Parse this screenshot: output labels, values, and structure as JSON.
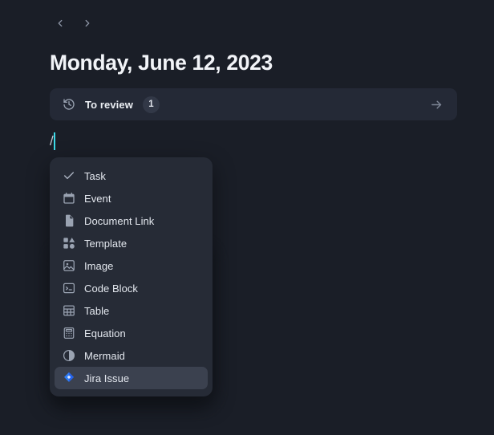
{
  "nav": {
    "prev_label": "Previous day",
    "next_label": "Next day",
    "prev_icon": "chevron-left-icon",
    "next_icon": "chevron-right-icon"
  },
  "header": {
    "title": "Monday, June 12, 2023"
  },
  "review_bar": {
    "icon": "history-icon",
    "label": "To review",
    "count": "1",
    "arrow_icon": "arrow-right-icon"
  },
  "editor": {
    "typed_text": "/",
    "caret_color": "#3ddbe8"
  },
  "slash_menu": {
    "items": [
      {
        "label": "Task",
        "icon": "check-icon"
      },
      {
        "label": "Event",
        "icon": "calendar-icon"
      },
      {
        "label": "Document Link",
        "icon": "document-icon"
      },
      {
        "label": "Template",
        "icon": "template-icon"
      },
      {
        "label": "Image",
        "icon": "image-icon"
      },
      {
        "label": "Code Block",
        "icon": "code-block-icon"
      },
      {
        "label": "Table",
        "icon": "table-icon"
      },
      {
        "label": "Equation",
        "icon": "calculator-icon"
      },
      {
        "label": "Mermaid",
        "icon": "pie-chart-icon"
      },
      {
        "label": "Jira Issue",
        "icon": "jira-icon",
        "selected": true
      }
    ]
  },
  "colors": {
    "page_background": "#1a1e27",
    "panel_background": "#262b36",
    "review_bar_background": "#242936",
    "selected_item_background": "#3b414f",
    "text_primary": "#f2f4f8",
    "text_secondary": "#e4e8ef",
    "icon_muted": "#9aa3b2",
    "jira_blue": "#2f7ef7",
    "caret_cyan": "#3ddbe8"
  }
}
